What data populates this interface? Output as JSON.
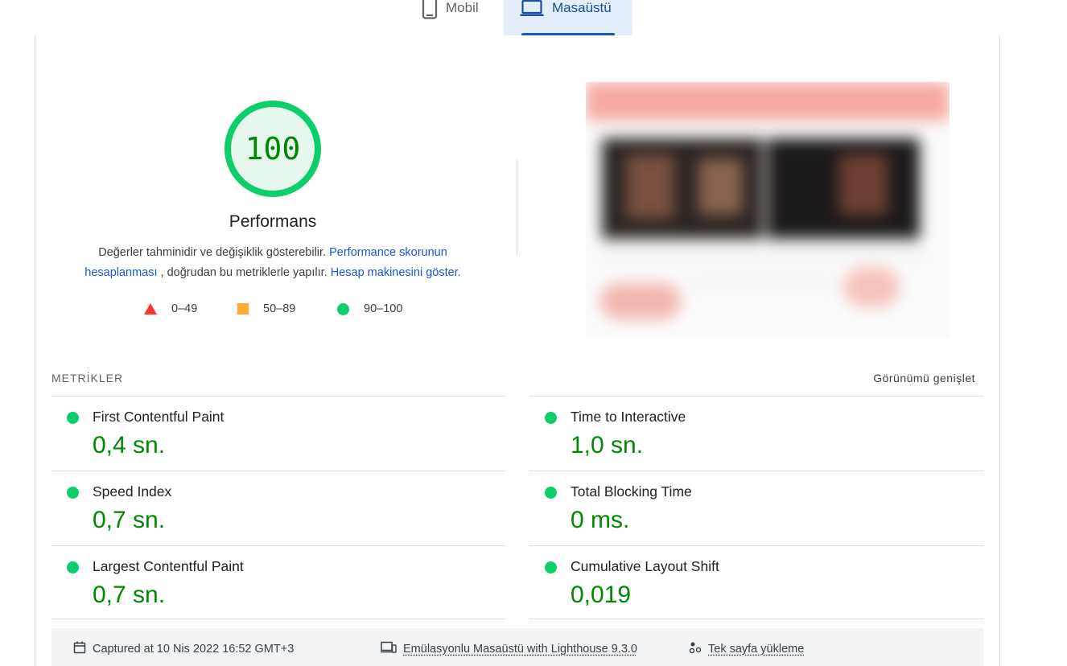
{
  "tabs": [
    {
      "label": "Mobil",
      "icon": "smartphone-icon",
      "active": false
    },
    {
      "label": "Masaüstü",
      "icon": "laptop-icon",
      "active": true
    }
  ],
  "gauge": {
    "score": "100",
    "title": "Performans",
    "desc_part1": "Değerler tahminidir ve değişiklik gösterebilir. ",
    "desc_link1": "Performance skorunun hesaplanması",
    "desc_part2": " , doğrudan bu metriklerle yapılır. ",
    "desc_link2": "Hesap makinesini göster.",
    "color": "#0cce6b",
    "score_color": "#008800"
  },
  "legend": {
    "fail": "0–49",
    "average": "50–89",
    "pass": "90–100"
  },
  "metrics": {
    "title": "METRİKLER",
    "expand_label": "Görünümü genişlet",
    "items": [
      {
        "title": "First Contentful Paint",
        "value": "0,4 sn."
      },
      {
        "title": "Time to Interactive",
        "value": "1,0 sn."
      },
      {
        "title": "Speed Index",
        "value": "0,7 sn."
      },
      {
        "title": "Total Blocking Time",
        "value": "0 ms."
      },
      {
        "title": "Largest Contentful Paint",
        "value": "0,7 sn."
      },
      {
        "title": "Cumulative Layout Shift",
        "value": "0,019"
      }
    ]
  },
  "footer": {
    "captured": "Captured at 10 Nis 2022 16:52 GMT+3",
    "device": "Emülasyonlu Masaüstü with Lighthouse 9.3.0",
    "load": "Tek sayfa yükleme"
  },
  "colors": {
    "pass": "#0cce6b",
    "average": "#ffaa33",
    "fail": "#ff3333",
    "accent": "#1a56db",
    "active_tab_bg": "#e4eefa"
  }
}
